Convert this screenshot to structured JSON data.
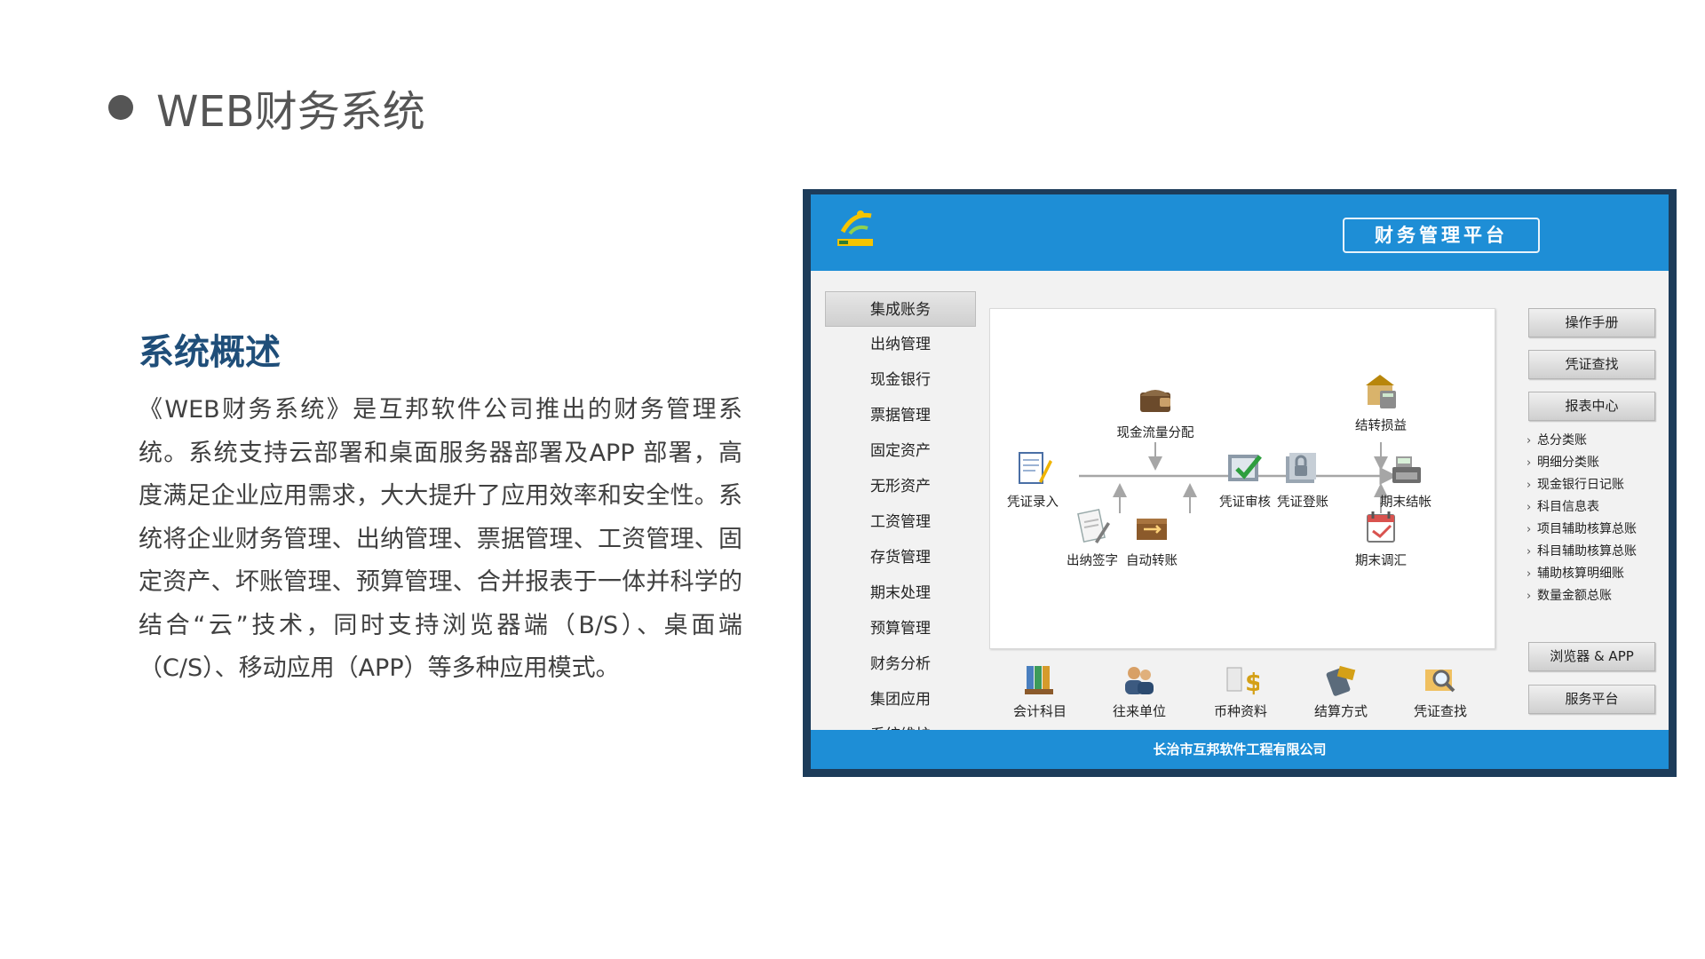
{
  "slide": {
    "title": "WEB财务系统",
    "overview_heading": "系统概述",
    "overview_text": "《WEB财务系统》是互邦软件公司推出的财务管理系统。系统支持云部署和桌面服务器部署及APP 部署，高度满足企业应用需求，大大提升了应用效率和安全性。系统将企业财务管理、出纳管理、票据管理、工资管理、固定资产、坏账管理、预算管理、合并报表于一体并科学的结合“云”技术，同时支持浏览器端（B/S）、桌面端（C/S）、移动应用（APP）等多种应用模式。"
  },
  "app": {
    "platform_title": "财务管理平台",
    "nav": [
      "集成账务",
      "出纳管理",
      "现金银行",
      "票据管理",
      "固定资产",
      "无形资产",
      "工资管理",
      "存货管理",
      "期末处理",
      "预算管理",
      "财务分析",
      "集团应用",
      "系统维护"
    ],
    "flow": {
      "cash_flow": "现金流量分配",
      "carry_profit": "结转损益",
      "voucher_entry": "凭证录入",
      "voucher_audit": "凭证审核",
      "voucher_post": "凭证登账",
      "period_close": "期末结帐",
      "cashier_sign": "出纳签字",
      "auto_transfer": "自动转账",
      "period_adjust": "期末调汇"
    },
    "tools": [
      "会计科目",
      "往来单位",
      "币种资料",
      "结算方式",
      "凭证查找"
    ],
    "right_buttons": {
      "manual": "操作手册",
      "voucher_search": "凭证查找",
      "report_center": "报表中心",
      "browser_app": "浏览器 & APP",
      "service_platform": "服务平台"
    },
    "reports": [
      "总分类账",
      "明细分类账",
      "现金银行日记账",
      "科目信息表",
      "项目辅助核算总账",
      "科目辅助核算总账",
      "辅助核算明细账",
      "数量金额总账"
    ],
    "footer": "长治市互邦软件工程有限公司",
    "colors": {
      "header_blue": "#1e8ed6",
      "frame_dark": "#1d3c5a",
      "heading_blue": "#1f4e79"
    }
  }
}
